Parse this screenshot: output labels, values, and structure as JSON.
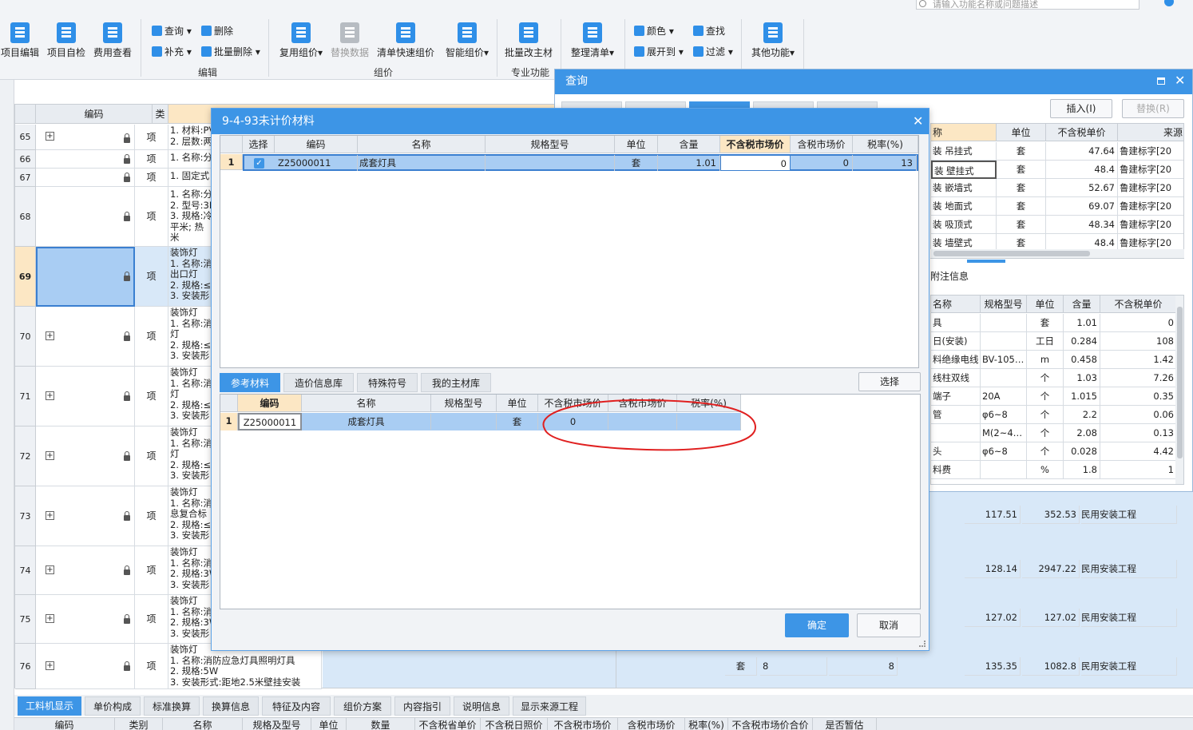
{
  "top_search": {
    "placeholder": "请输入功能名称或问题描述"
  },
  "ribbon": {
    "big_buttons": [
      {
        "label": "项目编辑"
      },
      {
        "label": "项目自检"
      },
      {
        "label": "费用查看"
      },
      {
        "label": "复用组价"
      },
      {
        "label": "替换数据"
      },
      {
        "label": "清单快速组价"
      },
      {
        "label": "智能组价"
      },
      {
        "label": "批量改主材"
      },
      {
        "label": "整理清单"
      },
      {
        "label": "其他功能"
      }
    ],
    "small_buttons": {
      "query": "查询",
      "delete": "删除",
      "supplement": "补充",
      "batch_delete": "批量删除",
      "color": "颜色",
      "find": "查找",
      "expand": "展开到",
      "filter": "过滤"
    },
    "groups": {
      "edit": "编辑",
      "pricing": "组价",
      "special": "专业功能"
    }
  },
  "grid": {
    "headers": {
      "code": "编码",
      "type": "类别"
    },
    "rows": [
      {
        "no": "65",
        "type": "项",
        "desc": "1. 材料:PV\n2. 层数:两"
      },
      {
        "no": "66",
        "type": "项",
        "desc": "1. 名称:分"
      },
      {
        "no": "67",
        "type": "项",
        "desc": "1. 固定式"
      },
      {
        "no": "68",
        "type": "项",
        "desc": "1. 名称:分\n2. 型号:3E\n3. 规格:冷\n平米; 热\n米"
      },
      {
        "no": "69",
        "type": "项",
        "desc": "装饰灯\n1. 名称:消\n出口灯\n2. 规格:≤\n3. 安装形"
      },
      {
        "no": "70",
        "type": "项",
        "desc": "装饰灯\n1. 名称:消\n灯\n2. 规格:≤\n3. 安装形"
      },
      {
        "no": "71",
        "type": "项",
        "desc": "装饰灯\n1. 名称:消\n灯\n2. 规格:≤\n3. 安装形"
      },
      {
        "no": "72",
        "type": "项",
        "desc": "装饰灯\n1. 名称:消\n灯\n2. 规格:≤\n3. 安装形"
      },
      {
        "no": "73",
        "type": "项",
        "desc": "装饰灯\n1. 名称:消\n息复合标\n2. 规格:≤\n3. 安装形"
      },
      {
        "no": "74",
        "type": "项",
        "desc": "装饰灯\n1. 名称:消\n2. 规格:3W\n3. 安装形"
      },
      {
        "no": "75",
        "type": "项",
        "desc": "装饰灯\n1. 名称:消\n2. 规格:3W\n3. 安装形"
      },
      {
        "no": "76",
        "type": "项",
        "desc": "装饰灯\n1. 名称:消防应急灯具照明灯具\n2. 规格:5W\n3. 安装形式:距地2.5米壁挂安装"
      }
    ],
    "right_rows": [
      {
        "v1": "117.51",
        "v2": "352.53",
        "v3": "民用安装工程"
      },
      {
        "v1": "128.14",
        "v2": "2947.22",
        "v3": "民用安装工程"
      },
      {
        "v1": "127.02",
        "v2": "127.02",
        "v3": "民用安装工程"
      },
      {
        "unit": "套",
        "qty": "8",
        "qty2": "8",
        "v1": "135.35",
        "v2": "1082.8",
        "v3": "民用安装工程"
      }
    ]
  },
  "query_panel": {
    "title": "查询",
    "insert_btn": "插入(I)",
    "replace_btn": "替换(R)",
    "upper_headers": [
      "称",
      "单位",
      "不含税单价",
      "来源"
    ],
    "upper_rows": [
      [
        "装 吊挂式",
        "套",
        "47.64",
        "鲁建标字[20"
      ],
      [
        "装 壁挂式",
        "套",
        "48.4",
        "鲁建标字[20"
      ],
      [
        "装 嵌墙式",
        "套",
        "52.67",
        "鲁建标字[20"
      ],
      [
        "装 地面式",
        "套",
        "69.07",
        "鲁建标字[20"
      ],
      [
        "装 吸顶式",
        "套",
        "48.34",
        "鲁建标字[20"
      ],
      [
        "装 墙壁式",
        "套",
        "48.4",
        "鲁建标字[20"
      ]
    ],
    "note_tab": "附注信息",
    "lower_headers": [
      "名称",
      "规格型号",
      "单位",
      "含量",
      "不含税单价"
    ],
    "lower_rows": [
      [
        "具",
        "",
        "套",
        "1.01",
        "0"
      ],
      [
        "日(安装)",
        "",
        "工日",
        "0.284",
        "108"
      ],
      [
        "料绝缘电线",
        "BV-105…",
        "m",
        "0.458",
        "1.42"
      ],
      [
        "线柱双线",
        "",
        "个",
        "1.03",
        "7.26"
      ],
      [
        "端子",
        "20A",
        "个",
        "1.015",
        "0.35"
      ],
      [
        "管",
        "φ6~8",
        "个",
        "2.2",
        "0.06"
      ],
      [
        "",
        "M(2~4…",
        "个",
        "2.08",
        "0.13"
      ],
      [
        "头",
        "φ6~8",
        "个",
        "0.028",
        "4.42"
      ],
      [
        "料费",
        "",
        "%",
        "1.8",
        "1"
      ]
    ]
  },
  "modal": {
    "title": "9-4-93未计价材料",
    "headers": [
      "选择",
      "编码",
      "名称",
      "规格型号",
      "单位",
      "含量",
      "不含税市场价",
      "含税市场价",
      "税率(%)"
    ],
    "row": {
      "no": "1",
      "code": "Z25000011",
      "name": "成套灯具",
      "spec": "",
      "unit": "套",
      "qty": "1.01",
      "price_ex": "0",
      "price_in": "0",
      "tax": "13"
    },
    "tabs": [
      "参考材料",
      "造价信息库",
      "特殊符号",
      "我的主材库"
    ],
    "select_btn": "选择",
    "ref_headers": [
      "编码",
      "名称",
      "规格型号",
      "单位",
      "不含税市场价",
      "含税市场价",
      "税率(%)"
    ],
    "ref_row": {
      "no": "1",
      "code": "Z25000011",
      "name": "成套灯具",
      "spec": "",
      "unit": "套",
      "price_ex": "0",
      "price_in": "",
      "tax": ""
    },
    "ok": "确定",
    "cancel": "取消"
  },
  "bottom_tabs": [
    "工料机显示",
    "单价构成",
    "标准换算",
    "换算信息",
    "特征及内容",
    "组价方案",
    "内容指引",
    "说明信息",
    "显示来源工程"
  ],
  "bottom_headers": [
    "编码",
    "类别",
    "名称",
    "规格及型号",
    "单位",
    "数量",
    "不含税省单价",
    "不含税日照价",
    "不含税市场价",
    "含税市场价",
    "税率(%)",
    "不含税市场价合价",
    "是否暂估"
  ],
  "colors": {
    "accent": "#3d95e6",
    "selected_row": "#a9cdf3",
    "annotation": "#e02020"
  }
}
